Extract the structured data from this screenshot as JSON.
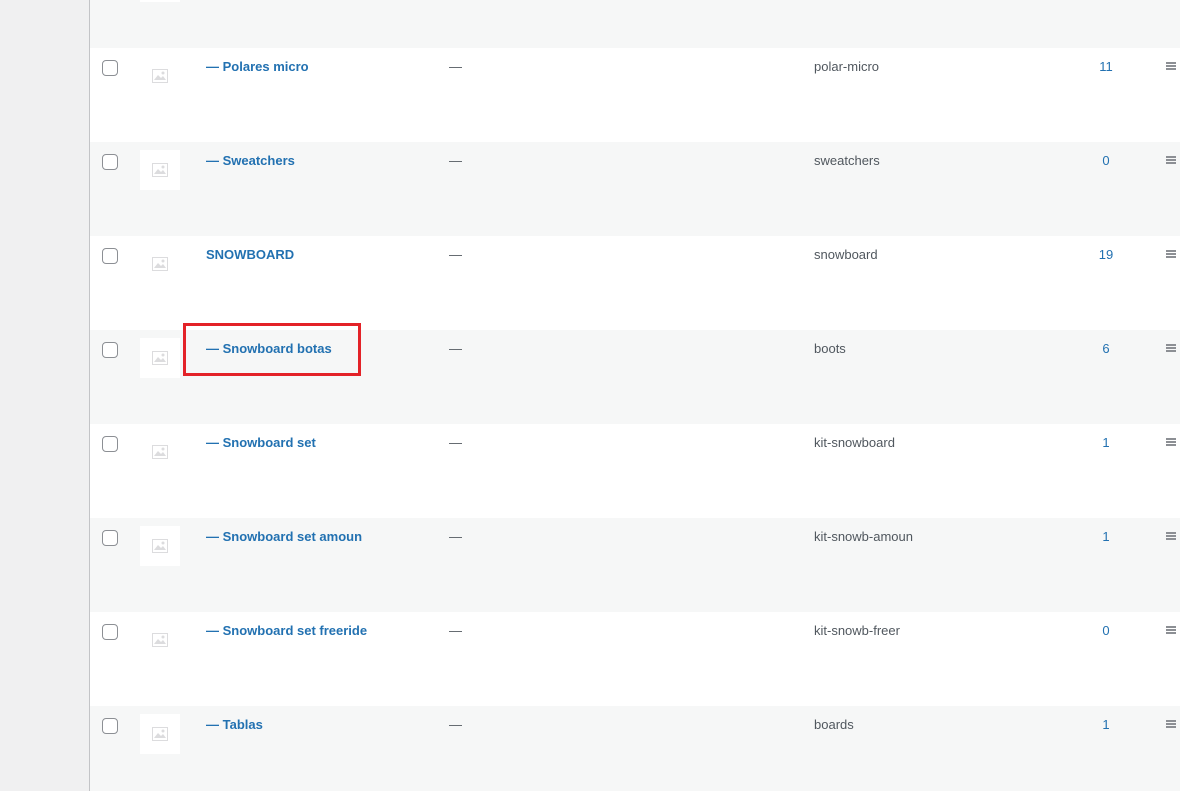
{
  "table": {
    "rows": [
      {
        "name": "— Polares micro",
        "description": "—",
        "slug": "polar-micro",
        "count": "11"
      },
      {
        "name": "— Sweatchers",
        "description": "—",
        "slug": "sweatchers",
        "count": "0"
      },
      {
        "name": "SNOWBOARD",
        "description": "—",
        "slug": "snowboard",
        "count": "19"
      },
      {
        "name": "— Snowboard botas",
        "description": "—",
        "slug": "boots",
        "count": "6"
      },
      {
        "name": "— Snowboard set",
        "description": "—",
        "slug": "kit-snowboard",
        "count": "1"
      },
      {
        "name": "— Snowboard set amoun",
        "description": "—",
        "slug": "kit-snowb-amoun",
        "count": "1"
      },
      {
        "name": "— Snowboard set freeride",
        "description": "—",
        "slug": "kit-snowb-freer",
        "count": "0"
      },
      {
        "name": "— Tablas",
        "description": "—",
        "slug": "boards",
        "count": "1"
      }
    ]
  },
  "colors": {
    "link": "#2271b1",
    "highlight": "#e32228",
    "alt_row": "#f6f7f7"
  },
  "icons": {
    "thumbnail": "image-placeholder-icon",
    "drag": "drag-handle-icon"
  }
}
